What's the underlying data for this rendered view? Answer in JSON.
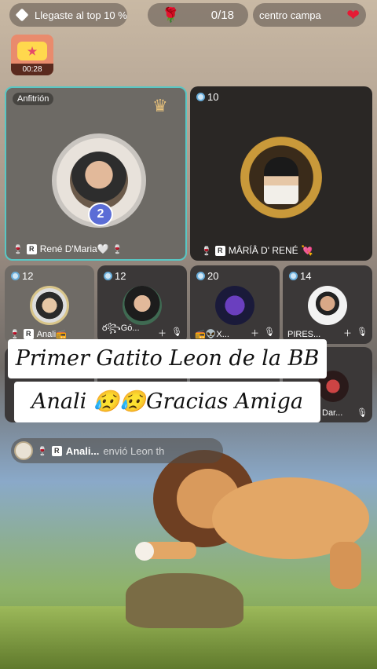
{
  "top_bar": {
    "rank_text": "Llegaste al top 10 %",
    "gift_count": "0/18",
    "room_title": "centro campa"
  },
  "timer": {
    "time": "00:28"
  },
  "host_tile": {
    "label": "Anfitrión",
    "level_badge": "2",
    "name": "René D'Maria🤍"
  },
  "cohost_tile": {
    "viewers": "10",
    "name": "MÂRÍÂ D' RENÉ"
  },
  "guests": [
    {
      "viewers": "12",
      "name": "Anali📻"
    },
    {
      "viewers": "12",
      "name": "ర꧂Gó..."
    },
    {
      "viewers": "20",
      "name": "📻👽X..."
    },
    {
      "viewers": "14",
      "name": "PIRES..."
    }
  ],
  "row3": [
    {
      "name": "Dar..."
    }
  ],
  "overlay_caption": {
    "line1": "Primer Gatito Leon de la BB",
    "line2": "Anali 😥😥Gracias Amiga"
  },
  "gift_notice": {
    "sender": "Anali...",
    "action": "envió Leon th"
  },
  "colors": {
    "host_border": "#58c7c4",
    "accent_red": "#e61a34"
  }
}
